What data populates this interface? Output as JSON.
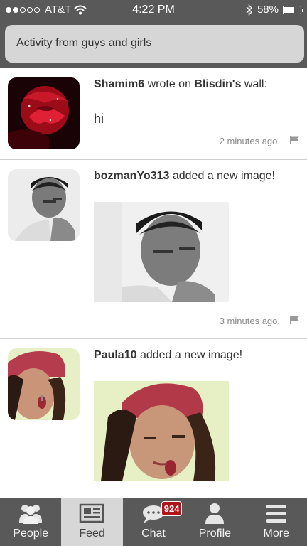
{
  "status_bar": {
    "carrier": "AT&T",
    "time": "4:22 PM",
    "battery": "58%"
  },
  "header": {
    "title": "Activity from guys and girls"
  },
  "feed": [
    {
      "user": "Shamim6",
      "action": "wrote on",
      "target": "Blisdin's",
      "target_suffix": "wall:",
      "message": "hi",
      "time": "2 minutes ago."
    },
    {
      "user": "bozmanYo313",
      "action": "added a new image!",
      "time": "3 minutes ago."
    },
    {
      "user": "Paula10",
      "action": "added a new image!"
    }
  ],
  "tabs": [
    {
      "label": "People",
      "icon": "people-icon"
    },
    {
      "label": "Feed",
      "icon": "newspaper-icon",
      "active": true
    },
    {
      "label": "Chat",
      "icon": "chat-bubble-icon",
      "badge": "924"
    },
    {
      "label": "Profile",
      "icon": "profile-icon"
    },
    {
      "label": "More",
      "icon": "menu-icon"
    }
  ],
  "colors": {
    "bar_background": "#595959",
    "active_tab": "#d7d7d7",
    "badge": "#b0141b"
  }
}
